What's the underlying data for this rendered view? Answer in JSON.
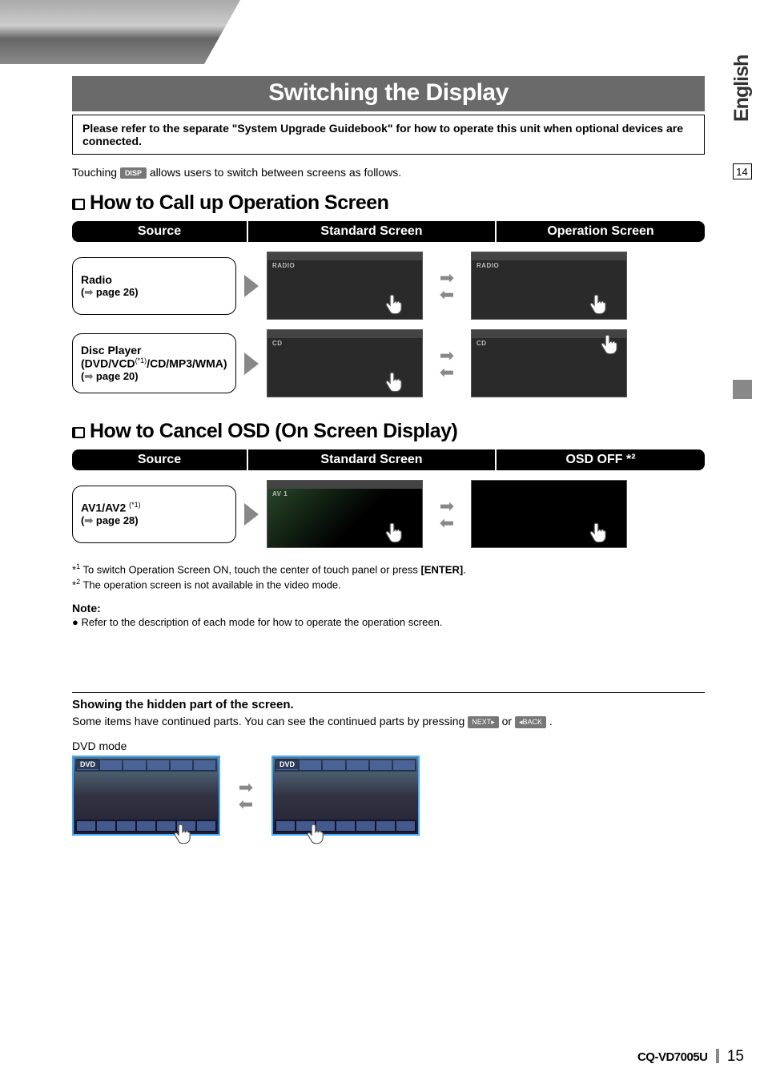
{
  "side": {
    "lang": "English",
    "topPage": "14"
  },
  "title": "Switching the Display",
  "noteBox": "Please refer to the separate \"System Upgrade Guidebook\" for how to operate this unit when optional devices are connected.",
  "intro": {
    "pre": "Touching ",
    "chip": "DISP",
    "post": " allows users to switch between screens as follows."
  },
  "section1": {
    "heading": "How to Call up Operation Screen",
    "cols": [
      "Source",
      "Standard Screen",
      "Operation Screen"
    ],
    "rows": [
      {
        "title": "Radio",
        "ref": "page 26",
        "thumbLabel": "RADIO"
      },
      {
        "title": "Disc Player (DVD/VCD",
        "starRef": "(*1)",
        "titleTail": "/CD/MP3/WMA)",
        "ref": "page 20",
        "thumbLabel": "CD"
      }
    ]
  },
  "section2": {
    "heading": "How to Cancel OSD (On Screen Display)",
    "cols": [
      "Source",
      "Standard Screen",
      "OSD OFF *²"
    ],
    "rows": [
      {
        "title": "AV1/AV2 ",
        "starRef": "(*1)",
        "ref": "page 28",
        "thumbLabel": "AV 1"
      }
    ]
  },
  "footnotes": {
    "f1": "To switch Operation Screen ON,  touch the center of touch panel or press ",
    "f1tail": "[ENTER]",
    "f1end": ".",
    "f2": "The operation screen is not available in the video mode."
  },
  "noteSection": {
    "head": "Note:",
    "body": "Refer to the description of each mode for how to operate the operation screen."
  },
  "hiddenSection": {
    "head": "Showing the hidden part of the screen.",
    "bodyPre": "Some items have continued parts. You can see the continued parts by pressing ",
    "chip1": "NEXT▸",
    "mid": " or ",
    "chip2": "◂BACK",
    "bodyPost": ".",
    "dvdLabel": "DVD mode",
    "dvdTag": "DVD"
  },
  "footer": {
    "model": "CQ-VD7005U",
    "page": "15"
  }
}
